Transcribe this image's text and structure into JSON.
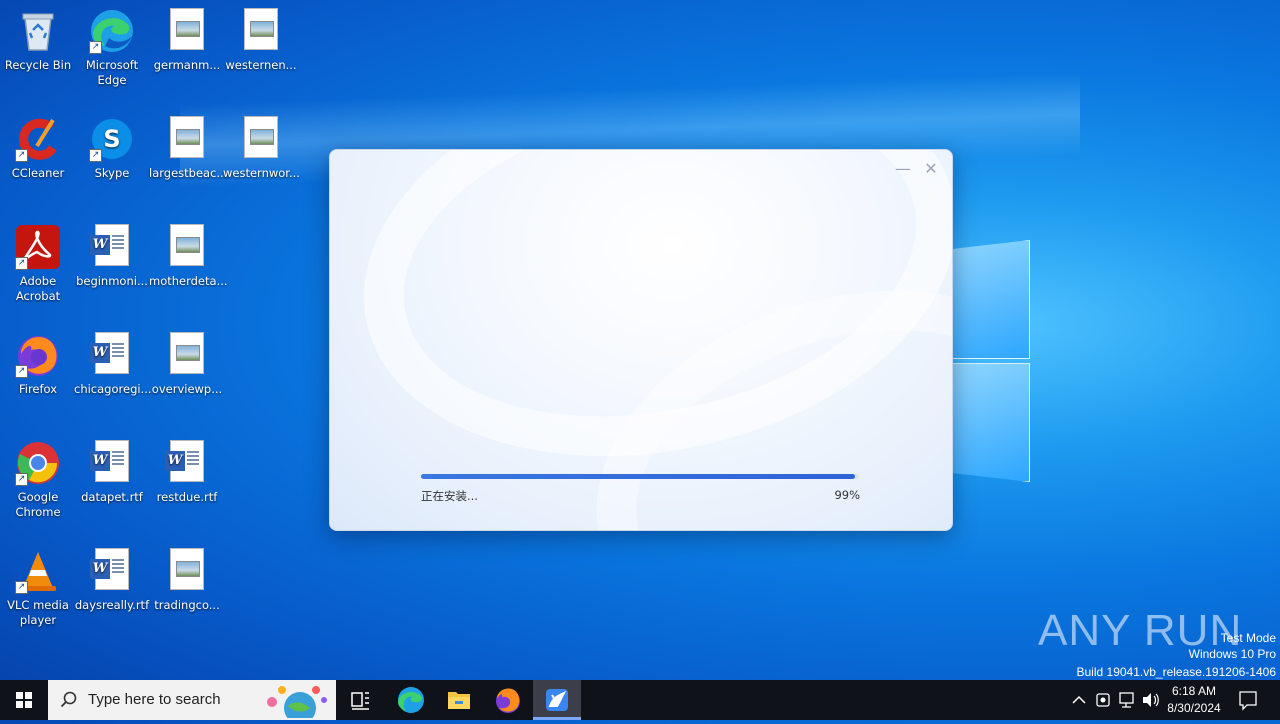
{
  "desktop": {
    "icons": [
      {
        "label": "Recycle Bin"
      },
      {
        "label": "Microsoft Edge"
      },
      {
        "label": "germanm..."
      },
      {
        "label": "westernen..."
      },
      {
        "label": "CCleaner"
      },
      {
        "label": "Skype"
      },
      {
        "label": "largestbeac..."
      },
      {
        "label": "westernwor..."
      },
      {
        "label": "Adobe Acrobat"
      },
      {
        "label": "beginmoni..."
      },
      {
        "label": "motherdeta..."
      },
      {
        "label": "Firefox"
      },
      {
        "label": "chicagoregi..."
      },
      {
        "label": "overviewp..."
      },
      {
        "label": "Google Chrome"
      },
      {
        "label": "datapet.rtf"
      },
      {
        "label": "restdue.rtf"
      },
      {
        "label": "VLC media player"
      },
      {
        "label": "daysreally.rtf"
      },
      {
        "label": "tradingco..."
      }
    ]
  },
  "installer": {
    "minimize_glyph": "—",
    "close_glyph": "✕",
    "status": "正在安装...",
    "percent": "99%",
    "progress": 0.99
  },
  "watermark": {
    "logo": "ANY RUN",
    "line1": "Test Mode",
    "line2": "Windows 10 Pro",
    "line3": "Build 19041.vb_release.191206-1406"
  },
  "taskbar": {
    "search_placeholder": "Type here to search",
    "time": "6:18 AM",
    "date": "8/30/2024",
    "icons": [
      "windows-start-icon",
      "search-icon",
      "task-view-icon",
      "edge-icon",
      "file-explorer-icon",
      "firefox-icon",
      "installer-app-icon",
      "chevron-up-icon",
      "network-icon",
      "volume-icon",
      "notification-icon"
    ]
  }
}
